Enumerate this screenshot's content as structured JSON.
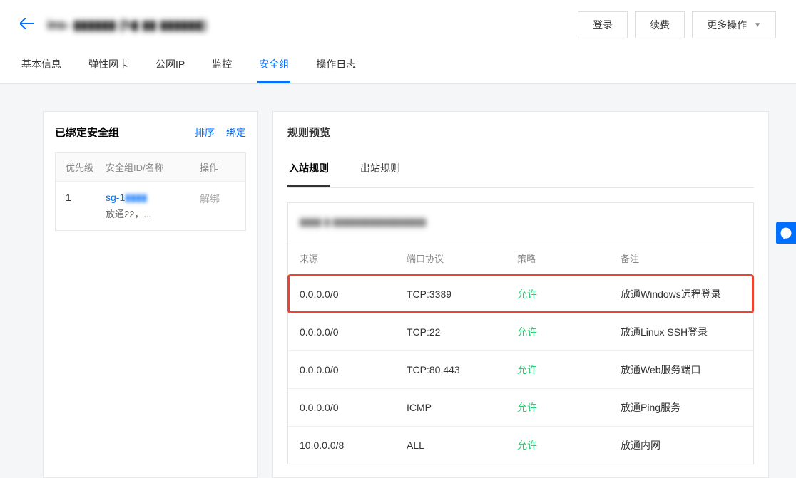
{
  "header": {
    "instance_name": "ins- ▮▮▮▮▮▮ (h▮ ▮▮ ▮▮▮▮▮▮)",
    "actions": {
      "login": "登录",
      "renew": "续费",
      "more": "更多操作"
    }
  },
  "tabs": [
    {
      "label": "基本信息",
      "active": false
    },
    {
      "label": "弹性网卡",
      "active": false
    },
    {
      "label": "公网IP",
      "active": false
    },
    {
      "label": "监控",
      "active": false
    },
    {
      "label": "安全组",
      "active": true
    },
    {
      "label": "操作日志",
      "active": false
    }
  ],
  "sg_panel": {
    "title": "已绑定安全组",
    "sort_label": "排序",
    "bind_label": "绑定",
    "columns": {
      "priority": "优先级",
      "name": "安全组ID/名称",
      "action": "操作"
    },
    "rows": [
      {
        "priority": "1",
        "id": "sg-1▮▮▮▮",
        "desc": "放通22，...",
        "action": "解绑"
      }
    ]
  },
  "rules_panel": {
    "title": "规则预览",
    "sub_tabs": [
      {
        "label": "入站规则",
        "active": true
      },
      {
        "label": "出站规则",
        "active": false
      }
    ],
    "group_header": "▮▮▮▮ ▮ ▮▮▮▮▮▮▮▮▮▮▮▮▮▮▮▮▮",
    "columns": {
      "source": "来源",
      "port": "端口协议",
      "policy": "策略",
      "remark": "备注"
    },
    "rules": [
      {
        "source": "0.0.0.0/0",
        "port": "TCP:3389",
        "policy": "允许",
        "remark": "放通Windows远程登录",
        "highlighted": true
      },
      {
        "source": "0.0.0.0/0",
        "port": "TCP:22",
        "policy": "允许",
        "remark": "放通Linux SSH登录",
        "highlighted": false
      },
      {
        "source": "0.0.0.0/0",
        "port": "TCP:80,443",
        "policy": "允许",
        "remark": "放通Web服务端口",
        "highlighted": false
      },
      {
        "source": "0.0.0.0/0",
        "port": "ICMP",
        "policy": "允许",
        "remark": "放通Ping服务",
        "highlighted": false
      },
      {
        "source": "10.0.0.0/8",
        "port": "ALL",
        "policy": "允许",
        "remark": "放通内网",
        "highlighted": false
      }
    ]
  }
}
